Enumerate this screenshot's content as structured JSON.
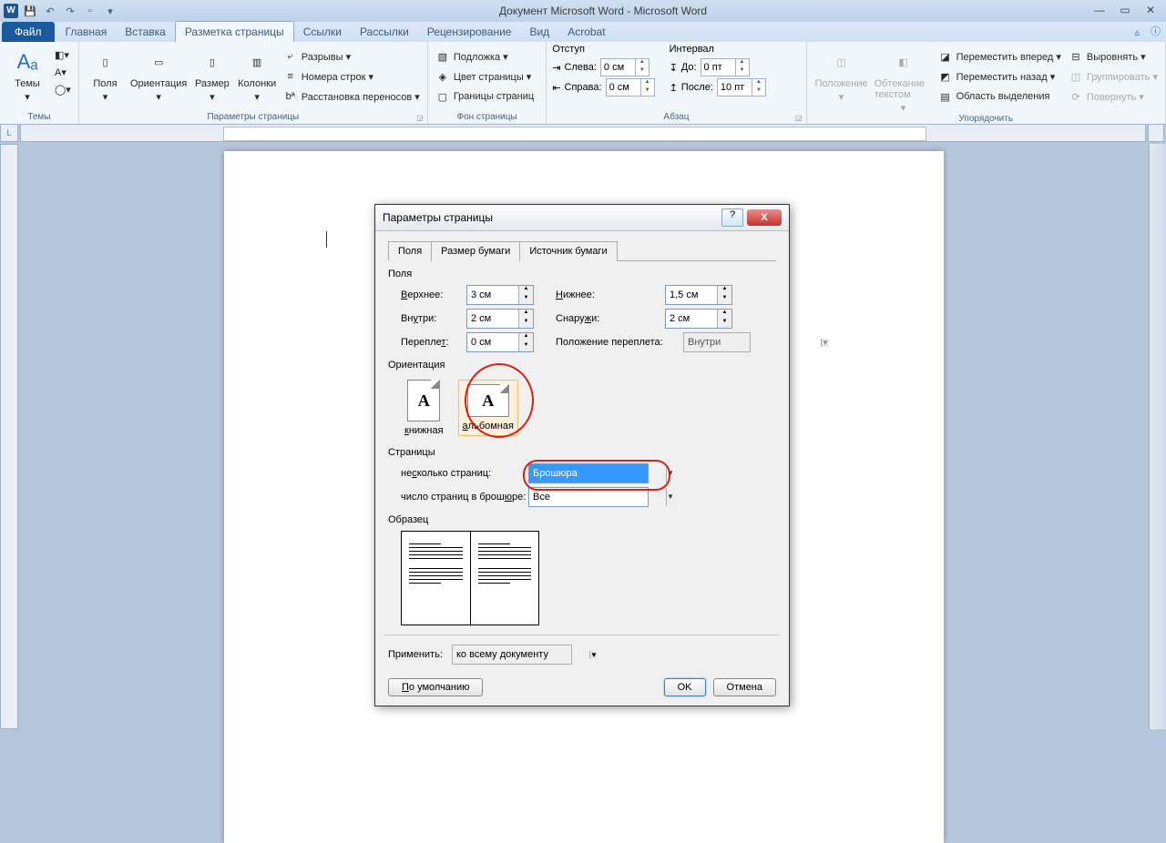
{
  "title": "Документ Microsoft Word  -  Microsoft Word",
  "tabs": {
    "file": "Файл",
    "home": "Главная",
    "insert": "Вставка",
    "layout": "Разметка страницы",
    "refs": "Ссылки",
    "mail": "Рассылки",
    "review": "Рецензирование",
    "view": "Вид",
    "acrobat": "Acrobat"
  },
  "ribbon": {
    "themes": {
      "label": "Темы",
      "btn": "Темы"
    },
    "page_setup": {
      "label": "Параметры страницы",
      "margins": "Поля",
      "orientation": "Ориентация",
      "size": "Размер",
      "columns": "Колонки",
      "breaks": "Разрывы ▾",
      "lines": "Номера строк ▾",
      "hyphen": "Расстановка переносов ▾"
    },
    "bg": {
      "label": "Фон страницы",
      "watermark": "Подложка ▾",
      "color": "Цвет страницы ▾",
      "borders": "Границы страниц"
    },
    "para": {
      "label": "Абзац",
      "indent": "Отступ",
      "left": "Слева:",
      "right": "Справа:",
      "lval": "0 см",
      "rval": "0 см",
      "spacing": "Интервал",
      "before": "До:",
      "after": "После:",
      "bval": "0 пт",
      "aval": "10 пт"
    },
    "arrange": {
      "label": "Упорядочить",
      "pos": "Положение",
      "wrap": "Обтекание текстом",
      "fwd": "Переместить вперед ▾",
      "back": "Переместить назад ▾",
      "pane": "Область выделения",
      "align": "Выровнять ▾",
      "group": "Группировать ▾",
      "rotate": "Повернуть ▾"
    }
  },
  "dialog": {
    "title": "Параметры страницы",
    "tabs": {
      "fields": "Поля",
      "paper": "Размер бумаги",
      "source": "Источник бумаги"
    },
    "sec_fields": "Поля",
    "top": "Верхнее:",
    "top_v": "3 см",
    "bottom": "Нижнее:",
    "bottom_v": "1,5 см",
    "inside": "Внутри:",
    "inside_v": "2 см",
    "outside": "Снаружи:",
    "outside_v": "2 см",
    "gutter": "Переплет:",
    "gutter_v": "0 см",
    "gutter_pos": "Положение переплета:",
    "gutter_pos_v": "Внутри",
    "sec_orient": "Ориентация",
    "portrait": "книжная",
    "landscape": "альбомная",
    "sec_pages": "Страницы",
    "multi": "несколько страниц:",
    "multi_v": "Брошюра",
    "sheets": "число страниц в брошюре:",
    "sheets_v": "Все",
    "sec_preview": "Образец",
    "apply": "Применить:",
    "apply_v": "ко всему документу",
    "default": "По умолчанию",
    "ok": "OK",
    "cancel": "Отмена"
  }
}
